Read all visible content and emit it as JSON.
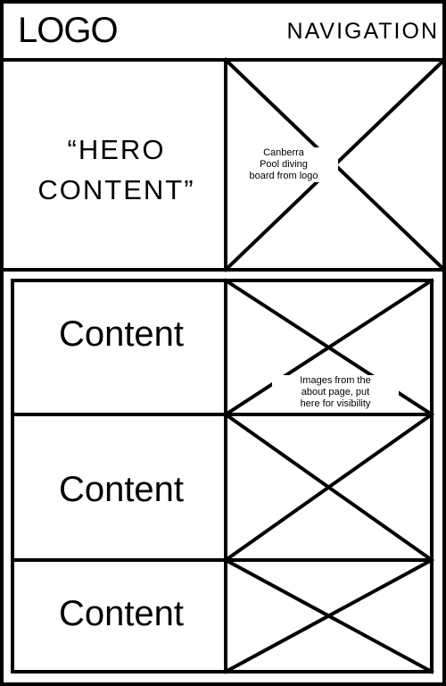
{
  "header": {
    "logo": "LOGO",
    "navigation": "NAVIGATION"
  },
  "hero": {
    "text_lines": [
      "“HERO",
      "CONTENT”"
    ],
    "image_caption_lines": [
      "Canberra",
      "Pool diving",
      "board from logo"
    ]
  },
  "sections": {
    "content_labels": [
      "Content",
      "Content",
      "Content"
    ],
    "image_caption_lines": [
      "Images from the",
      "about page, put",
      "here for visibility"
    ]
  }
}
